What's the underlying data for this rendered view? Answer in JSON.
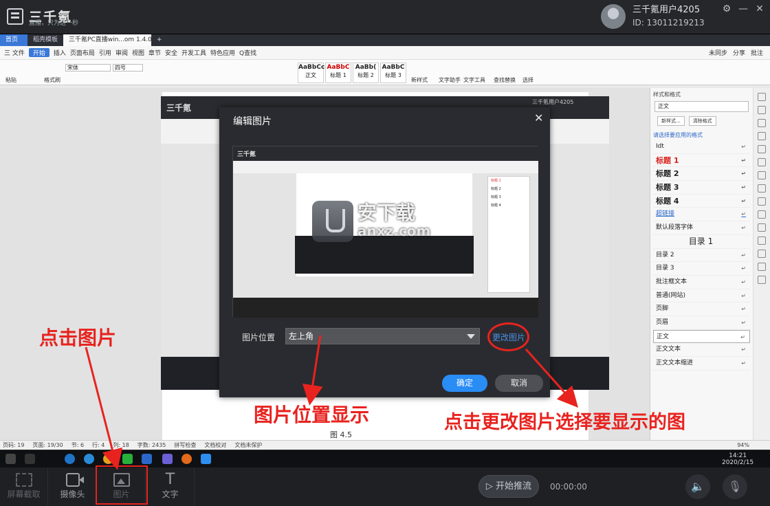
{
  "app": {
    "brand_name": "三千氪",
    "brand_tag": "直播，只为这一秒",
    "user_name": "三千氪用户4205",
    "user_id": "ID: 13011219213",
    "window_controls": [
      "gear-icon",
      "minimize-icon",
      "close-icon"
    ]
  },
  "wps": {
    "tabs": [
      "首页",
      "稻壳模板",
      "三千氪PC直播win...om 1.4.0.0",
      "+"
    ],
    "menu": [
      "三 文件",
      "开始",
      "插入",
      "页面布局",
      "引用",
      "审阅",
      "视图",
      "章节",
      "安全",
      "开发工具",
      "特色应用",
      "Q查找"
    ],
    "menu_right": [
      "未同步",
      "分享",
      "批注"
    ],
    "font": "宋体",
    "size": "四号",
    "styles": [
      {
        "sample": "AaBbCcDd",
        "name": "正文"
      },
      {
        "sample": "AaBbC",
        "name": "标题 1"
      },
      {
        "sample": "AaBb(",
        "name": "标题 2"
      },
      {
        "sample": "AaBbC",
        "name": "标题 3"
      }
    ],
    "ribbon_labels": [
      "粘贴",
      "格式刷",
      "新样式",
      "文字助手",
      "文字工具",
      "查找替换",
      "选择"
    ],
    "caption": "图 4.5",
    "status": [
      "页码: 19",
      "页面: 19/30",
      "节: 6",
      "行: 4",
      "列: 18",
      "字数: 2435",
      "拼写检查",
      "文档校对",
      "文档未保护"
    ],
    "zoom": "94%"
  },
  "style_panel": {
    "title": "样式和格式",
    "current": "正文",
    "new_style_btn": "新样式...",
    "clear_btn": "清除格式",
    "apply_label": "请选择要应用的格式",
    "items": [
      {
        "label": "Idt",
        "cls": ""
      },
      {
        "label": "标题 1",
        "cls": "red"
      },
      {
        "label": "标题 2",
        "cls": "bold"
      },
      {
        "label": "标题 3",
        "cls": "bold"
      },
      {
        "label": "标题 4",
        "cls": "bold"
      },
      {
        "label": "超链接",
        "cls": "link"
      },
      {
        "label": "默认段落字体",
        "cls": ""
      },
      {
        "label": "目录 1",
        "cls": "big"
      },
      {
        "label": "目录 2",
        "cls": ""
      },
      {
        "label": "目录 3",
        "cls": ""
      },
      {
        "label": "批注框文本",
        "cls": ""
      },
      {
        "label": "普通(网站)",
        "cls": ""
      },
      {
        "label": "页脚",
        "cls": ""
      },
      {
        "label": "页眉",
        "cls": ""
      },
      {
        "label": "正文",
        "cls": "sel"
      },
      {
        "label": "正文文本",
        "cls": ""
      },
      {
        "label": "正文文本缩进",
        "cls": ""
      }
    ]
  },
  "dialog": {
    "title": "编辑图片",
    "close": "✕",
    "watermark_text": "安下载",
    "watermark_url": "anxz.com",
    "position_label": "图片位置",
    "position_value": "左上角",
    "change_link": "更改图片",
    "ok": "确定",
    "cancel": "取消"
  },
  "annotations": {
    "click_image": "点击图片",
    "position_display": "图片位置显示",
    "change_hint": "点击更改图片选择要显示的图",
    "color": "#e8231f"
  },
  "taskbar": {
    "time": "14:21",
    "date": "2020/2/15"
  },
  "bottom": {
    "tools": [
      {
        "label": "屏幕截取",
        "icon": "screen-capture-icon"
      },
      {
        "label": "摄像头",
        "icon": "camera-icon"
      },
      {
        "label": "图片",
        "icon": "image-icon"
      },
      {
        "label": "文字",
        "icon": "text-icon"
      }
    ],
    "start_push": "▷ 开始推流",
    "timer": "00:00:00",
    "speaker_icon": "speaker-icon",
    "mic_icon": "microphone-icon"
  }
}
